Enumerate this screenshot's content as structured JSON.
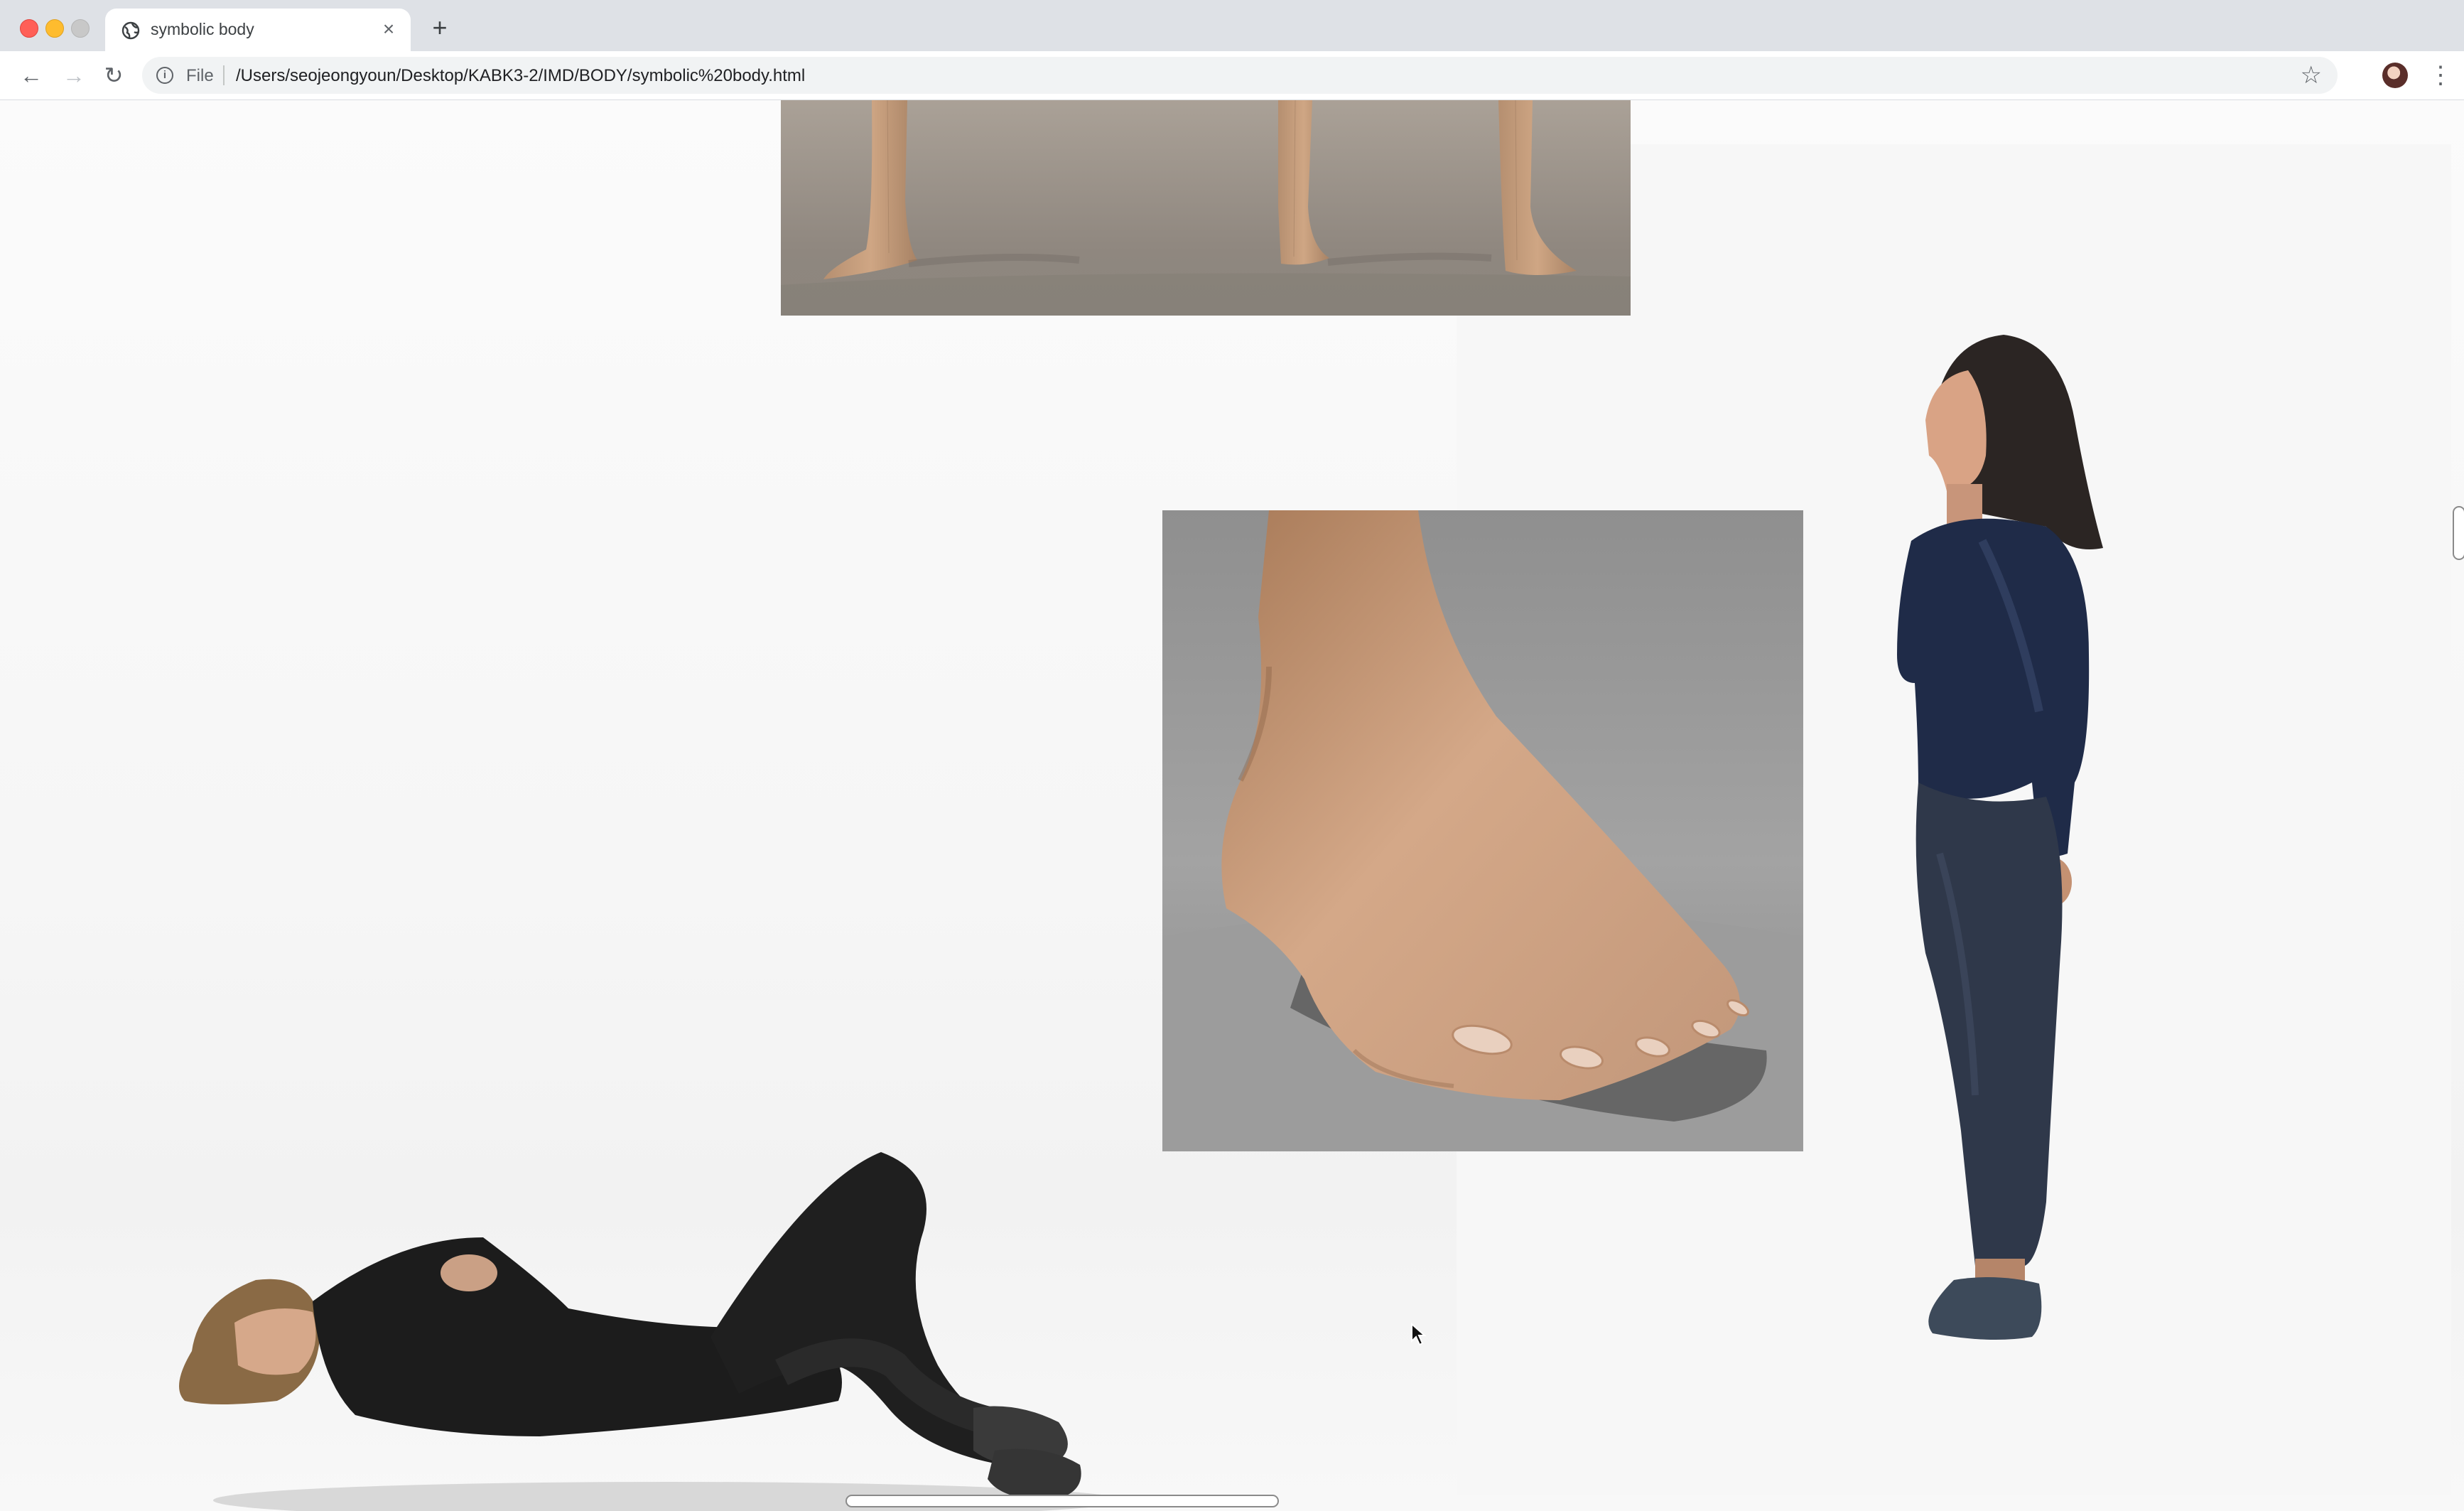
{
  "browser": {
    "tab": {
      "title": "symbolic body",
      "icon": "globe-icon",
      "close_symbol": "×"
    },
    "new_tab_symbol": "+",
    "toolbar": {
      "back_symbol": "←",
      "forward_symbol": "→",
      "reload_symbol": "↻",
      "info_symbol": "i",
      "scheme_label": "File",
      "url": "/Users/seojeongyoun/Desktop/KABK3-2/IMD/BODY/symbolic%20body.html",
      "bookmark_symbol": "☆",
      "menu_symbol": "⋮"
    }
  },
  "colors": {
    "tabbar": "#dee1e6",
    "close_red": "#ff5f57",
    "minimize_yellow": "#febc2e",
    "zoom_gray": "#c8c8c8",
    "omnibox": "#f1f3f4"
  },
  "page": {
    "images": [
      {
        "name": "3d-legs-image",
        "description_icon": "legs-render"
      },
      {
        "name": "3d-foot-image",
        "description_icon": "foot-render"
      },
      {
        "name": "standing-person-photo",
        "description_icon": "person-standing"
      },
      {
        "name": "lying-person-photo",
        "description_icon": "person-lying"
      }
    ]
  }
}
